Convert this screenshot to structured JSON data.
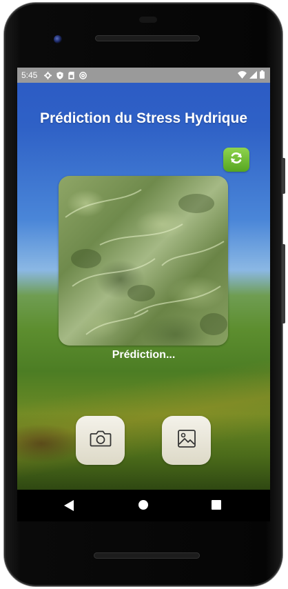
{
  "status_bar": {
    "time": "5:45",
    "left_icons": [
      "settings-icon",
      "shield-icon",
      "sim-card-icon",
      "at-sign-icon"
    ],
    "right_icons": [
      "wifi-icon",
      "signal-icon",
      "battery-icon"
    ]
  },
  "app": {
    "title": "Prédiction du Stress Hydrique",
    "refresh_icon": "refresh-icon",
    "accent_color": "#6bbf2f",
    "prediction_text": "Prédiction...",
    "camera_icon": "camera-icon",
    "gallery_icon": "image-icon"
  },
  "nav_bar": {
    "buttons": [
      "back-icon",
      "home-icon",
      "recents-icon"
    ]
  }
}
